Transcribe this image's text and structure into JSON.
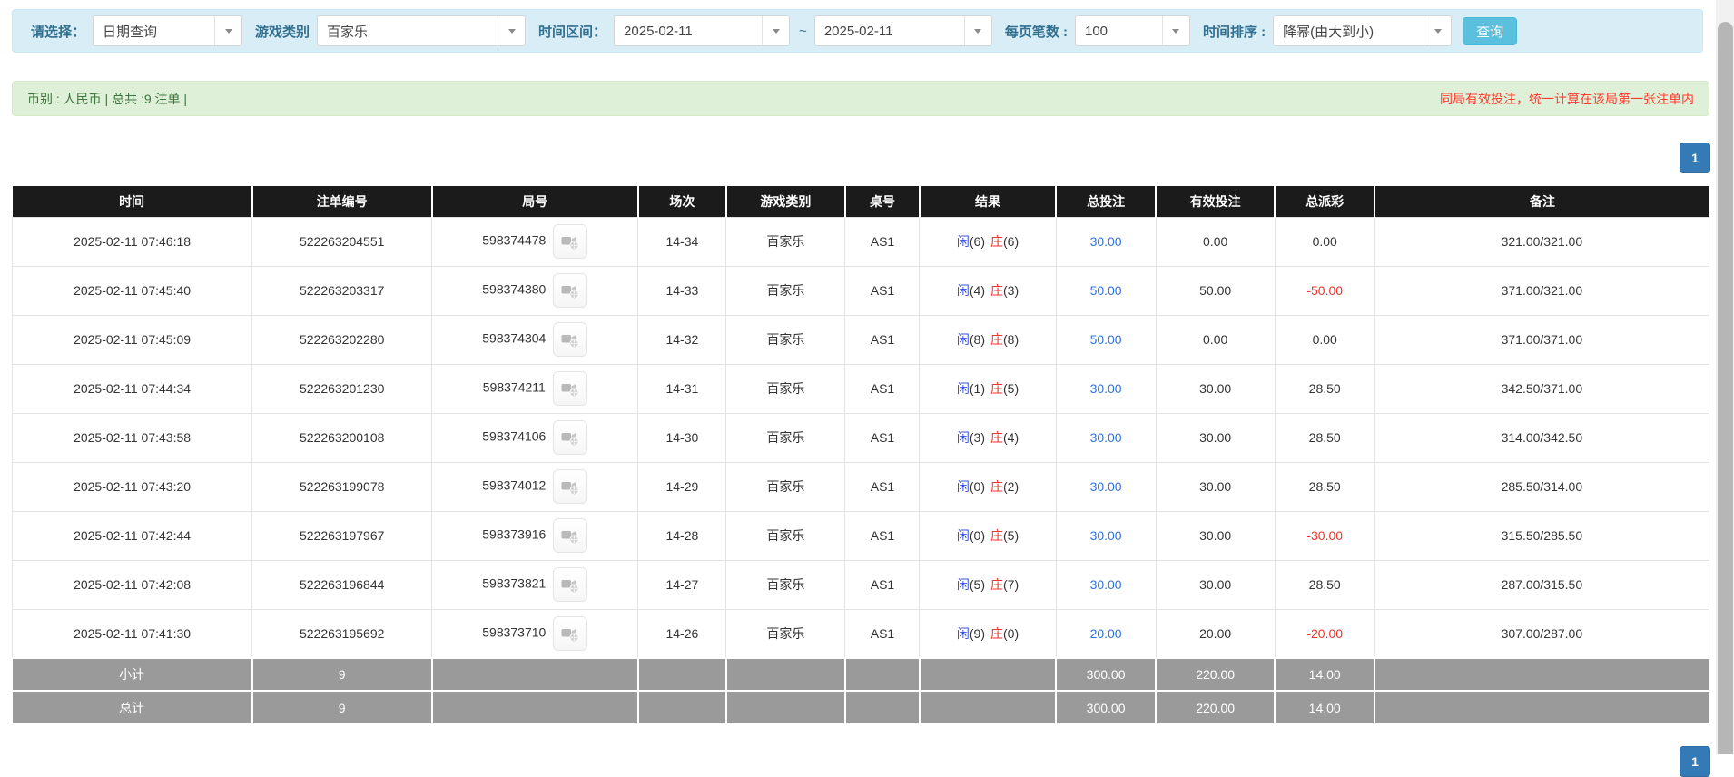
{
  "filter_bar": {
    "select_label": "请选择：",
    "select_value": "日期查询",
    "game_type_label": "游戏类别",
    "game_type_value": "百家乐",
    "time_range_label": "时间区间：",
    "date_from": "2025-02-11",
    "date_separator": "~",
    "date_to": "2025-02-11",
    "page_size_label": "每页笔数 :",
    "page_size_value": "100",
    "sort_label": "时间排序 :",
    "sort_value": "降幂(由大到小)",
    "search_button_label": "查询"
  },
  "summary_bar": {
    "info_text": "币别 : 人民币 | 总共 :9 注单 |",
    "notice_text": "同局有效投注，统一计算在该局第一张注单内"
  },
  "pagination": {
    "current_page": "1"
  },
  "table": {
    "headers": [
      "时间",
      "注单编号",
      "局号",
      "场次",
      "游戏类别",
      "桌号",
      "结果",
      "总投注",
      "有效投注",
      "总派彩",
      "备注"
    ],
    "rows": [
      {
        "time": "2025-02-11 07:46:18",
        "bet_id": "522263204551",
        "round_id": "598374478",
        "session": "14-34",
        "game": "百家乐",
        "table_no": "AS1",
        "result": {
          "player_label": "闲",
          "player_score": "(6)",
          "banker_label": "庄",
          "banker_score": "(6)"
        },
        "total_bet": "30.00",
        "valid_bet": "0.00",
        "payout": "0.00",
        "note": "321.00/321.00"
      },
      {
        "time": "2025-02-11 07:45:40",
        "bet_id": "522263203317",
        "round_id": "598374380",
        "session": "14-33",
        "game": "百家乐",
        "table_no": "AS1",
        "result": {
          "player_label": "闲",
          "player_score": "(4)",
          "banker_label": "庄",
          "banker_score": "(3)"
        },
        "total_bet": "50.00",
        "valid_bet": "50.00",
        "payout": "-50.00",
        "note": "371.00/321.00"
      },
      {
        "time": "2025-02-11 07:45:09",
        "bet_id": "522263202280",
        "round_id": "598374304",
        "session": "14-32",
        "game": "百家乐",
        "table_no": "AS1",
        "result": {
          "player_label": "闲",
          "player_score": "(8)",
          "banker_label": "庄",
          "banker_score": "(8)"
        },
        "total_bet": "50.00",
        "valid_bet": "0.00",
        "payout": "0.00",
        "note": "371.00/371.00"
      },
      {
        "time": "2025-02-11 07:44:34",
        "bet_id": "522263201230",
        "round_id": "598374211",
        "session": "14-31",
        "game": "百家乐",
        "table_no": "AS1",
        "result": {
          "player_label": "闲",
          "player_score": "(1)",
          "banker_label": "庄",
          "banker_score": "(5)"
        },
        "total_bet": "30.00",
        "valid_bet": "30.00",
        "payout": "28.50",
        "note": "342.50/371.00"
      },
      {
        "time": "2025-02-11 07:43:58",
        "bet_id": "522263200108",
        "round_id": "598374106",
        "session": "14-30",
        "game": "百家乐",
        "table_no": "AS1",
        "result": {
          "player_label": "闲",
          "player_score": "(3)",
          "banker_label": "庄",
          "banker_score": "(4)"
        },
        "total_bet": "30.00",
        "valid_bet": "30.00",
        "payout": "28.50",
        "note": "314.00/342.50"
      },
      {
        "time": "2025-02-11 07:43:20",
        "bet_id": "522263199078",
        "round_id": "598374012",
        "session": "14-29",
        "game": "百家乐",
        "table_no": "AS1",
        "result": {
          "player_label": "闲",
          "player_score": "(0)",
          "banker_label": "庄",
          "banker_score": "(2)"
        },
        "total_bet": "30.00",
        "valid_bet": "30.00",
        "payout": "28.50",
        "note": "285.50/314.00"
      },
      {
        "time": "2025-02-11 07:42:44",
        "bet_id": "522263197967",
        "round_id": "598373916",
        "session": "14-28",
        "game": "百家乐",
        "table_no": "AS1",
        "result": {
          "player_label": "闲",
          "player_score": "(0)",
          "banker_label": "庄",
          "banker_score": "(5)"
        },
        "total_bet": "30.00",
        "valid_bet": "30.00",
        "payout": "-30.00",
        "note": "315.50/285.50"
      },
      {
        "time": "2025-02-11 07:42:08",
        "bet_id": "522263196844",
        "round_id": "598373821",
        "session": "14-27",
        "game": "百家乐",
        "table_no": "AS1",
        "result": {
          "player_label": "闲",
          "player_score": "(5)",
          "banker_label": "庄",
          "banker_score": "(7)"
        },
        "total_bet": "30.00",
        "valid_bet": "30.00",
        "payout": "28.50",
        "note": "287.00/315.50"
      },
      {
        "time": "2025-02-11 07:41:30",
        "bet_id": "522263195692",
        "round_id": "598373710",
        "session": "14-26",
        "game": "百家乐",
        "table_no": "AS1",
        "result": {
          "player_label": "闲",
          "player_score": "(9)",
          "banker_label": "庄",
          "banker_score": "(0)"
        },
        "total_bet": "20.00",
        "valid_bet": "20.00",
        "payout": "-20.00",
        "note": "307.00/287.00"
      }
    ],
    "subtotal": {
      "label": "小计",
      "count": "9",
      "total_bet": "300.00",
      "valid_bet": "220.00",
      "payout": "14.00"
    },
    "grand_total": {
      "label": "总计",
      "count": "9",
      "total_bet": "300.00",
      "valid_bet": "220.00",
      "payout": "14.00"
    }
  },
  "colors": {
    "filter_bar_bg": "#d9edf7",
    "summary_bar_bg": "#dff0d8",
    "header_bg": "#1b1b1b",
    "subtotal_bg": "#9a9a9a",
    "search_button_bg": "#5bc0de",
    "pager_active_bg": "#337ab7",
    "player_blue": "#3350e8",
    "banker_red": "#f2332b",
    "bet_link_blue": "#3273dc",
    "negative_red": "#f2332b",
    "notice_red": "#ff3b2f"
  }
}
